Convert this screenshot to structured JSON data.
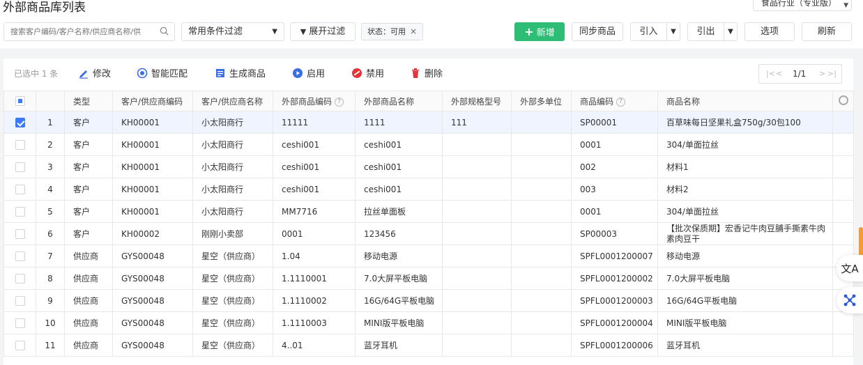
{
  "header": {
    "title": "外部商品库列表",
    "industry": "食品行业（专业版）"
  },
  "filter": {
    "search_placeholder": "搜索客户编码/客户名称/供应商名称/供",
    "preset": "常用条件过滤",
    "expand": "展开过滤",
    "tag": "状态：可用"
  },
  "toolbar": {
    "add": "新增",
    "sync": "同步商品",
    "import": "引入",
    "export": "引出",
    "options": "选项",
    "refresh": "刷新"
  },
  "actions": {
    "selected": "已选中 1 条",
    "edit": "修改",
    "match": "智能匹配",
    "generate": "生成商品",
    "enable": "启用",
    "disable": "禁用",
    "delete": "删除",
    "page": "1/1"
  },
  "columns": [
    "类型",
    "客户/供应商编码",
    "客户/供应商名称",
    "外部商品编码",
    "外部商品名称",
    "外部规格型号",
    "外部多单位",
    "商品编码",
    "商品名称"
  ],
  "rows": [
    [
      "1",
      "客户",
      "KH00001",
      "小太阳商行",
      "11111",
      "1111",
      "111",
      "",
      "SP00001",
      "百草味每日坚果礼盒750g/30包100"
    ],
    [
      "2",
      "客户",
      "KH00001",
      "小太阳商行",
      "ceshi001",
      "ceshi001",
      "",
      "",
      "0001",
      "304/单面拉丝"
    ],
    [
      "3",
      "客户",
      "KH00001",
      "小太阳商行",
      "ceshi001",
      "ceshi001",
      "",
      "",
      "002",
      "材料1"
    ],
    [
      "4",
      "客户",
      "KH00001",
      "小太阳商行",
      "ceshi001",
      "ceshi001",
      "",
      "",
      "003",
      "材料2"
    ],
    [
      "5",
      "客户",
      "KH00001",
      "小太阳商行",
      "MM7716",
      "拉丝单面板",
      "",
      "",
      "0001",
      "304/单面拉丝"
    ],
    [
      "6",
      "客户",
      "KH00002",
      "刚刚小卖部",
      "0001",
      "123456",
      "",
      "",
      "SP00003",
      "【批次保质期】宏香记牛肉豆脯手撕素牛肉素肉豆干"
    ],
    [
      "7",
      "供应商",
      "GYS00048",
      "星空（供应商）",
      "1.04",
      "移动电源",
      "",
      "",
      "SPFL0001200007",
      "移动电源"
    ],
    [
      "8",
      "供应商",
      "GYS00048",
      "星空（供应商）",
      "1.1110001",
      "7.0大屏平板电脑",
      "",
      "",
      "SPFL0001200002",
      "7.0大屏平板电脑"
    ],
    [
      "9",
      "供应商",
      "GYS00048",
      "星空（供应商）",
      "1.1110002",
      "16G/64G平板电脑",
      "",
      "",
      "SPFL0001200003",
      "16G/64G平板电脑"
    ],
    [
      "10",
      "供应商",
      "GYS00048",
      "星空（供应商）",
      "1.1110003",
      "MINI版平板电脑",
      "",
      "",
      "SPFL0001200004",
      "MINI版平板电脑"
    ],
    [
      "11",
      "供应商",
      "GYS00048",
      "星空（供应商）",
      "4..01",
      "蓝牙耳机",
      "",
      "",
      "SPFL0001200006",
      "蓝牙耳机"
    ]
  ],
  "colors": {
    "primary": "#2ebd75",
    "accent": "#3a7bf7",
    "danger": "#e5343a"
  }
}
